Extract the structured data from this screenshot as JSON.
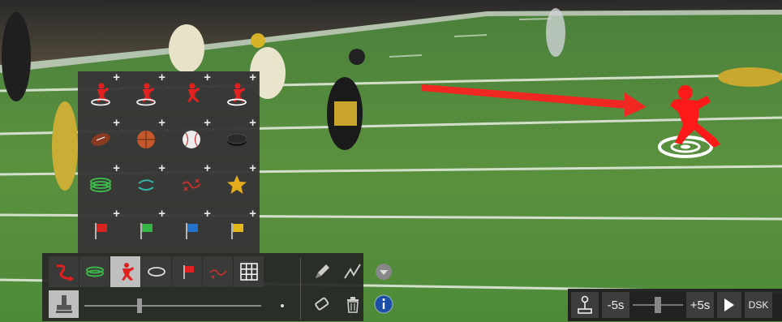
{
  "palette": {
    "rows": [
      [
        {
          "icon": "player-target-icon",
          "color": "#e32121"
        },
        {
          "icon": "player-run-target-icon",
          "color": "#e32121"
        },
        {
          "icon": "player-sprint-icon",
          "color": "#e32121"
        },
        {
          "icon": "player-target-white-icon",
          "color": "#e32121"
        }
      ],
      [
        {
          "icon": "football-icon",
          "color": "#8a3a22"
        },
        {
          "icon": "basketball-icon",
          "color": "#c5582a"
        },
        {
          "icon": "baseball-icon",
          "color": "#ececec"
        },
        {
          "icon": "hockey-puck-icon",
          "color": "#111111"
        }
      ],
      [
        {
          "icon": "green-rings-icon",
          "color": "#3db54a"
        },
        {
          "icon": "teal-arc-arrows-icon",
          "color": "#35b3a4"
        },
        {
          "icon": "red-route-x-icon",
          "color": "#c8322b"
        },
        {
          "icon": "star-icon",
          "color": "#e4ac1d"
        }
      ],
      [
        {
          "icon": "red-flag-icon",
          "color": "#d8231f"
        },
        {
          "icon": "green-flag-icon",
          "color": "#35b544"
        },
        {
          "icon": "blue-flag-icon",
          "color": "#2173cc"
        },
        {
          "icon": "yellow-flag-icon",
          "color": "#e4b81a"
        }
      ]
    ],
    "add_symbol": "+"
  },
  "toolbar": {
    "tools": [
      {
        "icon": "curved-arrow-icon",
        "active": false
      },
      {
        "icon": "ring-stack-icon",
        "active": false
      },
      {
        "icon": "player-stamp-icon",
        "active": true
      },
      {
        "icon": "ellipse-icon",
        "active": false
      },
      {
        "icon": "flag-icon",
        "active": false
      },
      {
        "icon": "route-icon",
        "active": false
      },
      {
        "icon": "grid-icon",
        "active": false
      }
    ],
    "right": [
      "pencil-icon",
      "freehand-line-icon",
      "dropdown-icon",
      "eraser-icon",
      "trash-icon",
      "info-icon"
    ],
    "stamp_icon": "stamp-icon",
    "size_level": 0.3
  },
  "playbar": {
    "rewind_icon": "joystick-icon",
    "back_label": "-5s",
    "forward_label": "+5s",
    "play_icon": "play-icon",
    "dsk_label": "DSK",
    "jog_position": 0.5
  },
  "colors": {
    "accent_red": "#ff2020",
    "field_green": "#4d8a3a"
  }
}
